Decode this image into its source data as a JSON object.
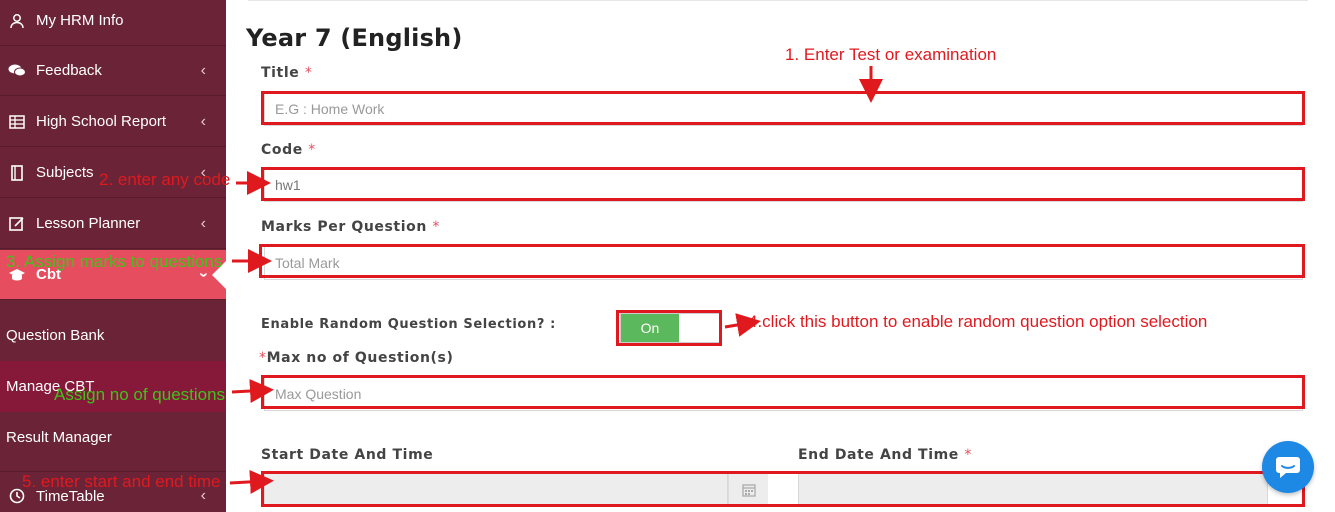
{
  "sidebar": {
    "items": [
      {
        "label": "My HRM Info",
        "icon": "user-icon"
      },
      {
        "label": "Feedback",
        "icon": "comments-icon"
      },
      {
        "label": "High School Report",
        "icon": "table-icon"
      },
      {
        "label": "Subjects",
        "icon": "book-icon"
      },
      {
        "label": "Lesson Planner",
        "icon": "edit-icon"
      },
      {
        "label": "Cbt",
        "icon": "graduation-cap-icon"
      },
      {
        "label": "TimeTable",
        "icon": "clock-icon"
      }
    ],
    "subitems": [
      {
        "label": "Question Bank"
      },
      {
        "label": "Manage CBT"
      },
      {
        "label": "Result Manager"
      }
    ]
  },
  "form": {
    "title": "Year 7 (English)",
    "required_mark": "*",
    "fields": {
      "title": {
        "label": "Title",
        "placeholder": "E.G : Home Work"
      },
      "code": {
        "label": "Code",
        "value": "hw1"
      },
      "marks": {
        "label": "Marks Per Question",
        "placeholder": "Total Mark"
      },
      "random": {
        "label": "Enable Random Question Selection? :",
        "toggle": "On"
      },
      "max": {
        "label": "Max no of Question(s)",
        "placeholder": "Max Question"
      },
      "start": {
        "label": "Start Date And Time"
      },
      "end": {
        "label": "End Date And Time"
      }
    }
  },
  "annotations": {
    "a1": "1. Enter Test or examination",
    "a2": "2. enter any code",
    "a3": "3. Assign marks to questions",
    "a4": "4.click this button to enable random question option selection",
    "a5": "Assign no of questions",
    "a6": "5. enter start and end time"
  },
  "colors": {
    "sidebar": "#6b2437",
    "active": "#e64e5f",
    "annotation_red": "#e0191f",
    "annotation_green": "#3fc31a",
    "toggle_on": "#5cb85c",
    "chat": "#1e88e5"
  }
}
